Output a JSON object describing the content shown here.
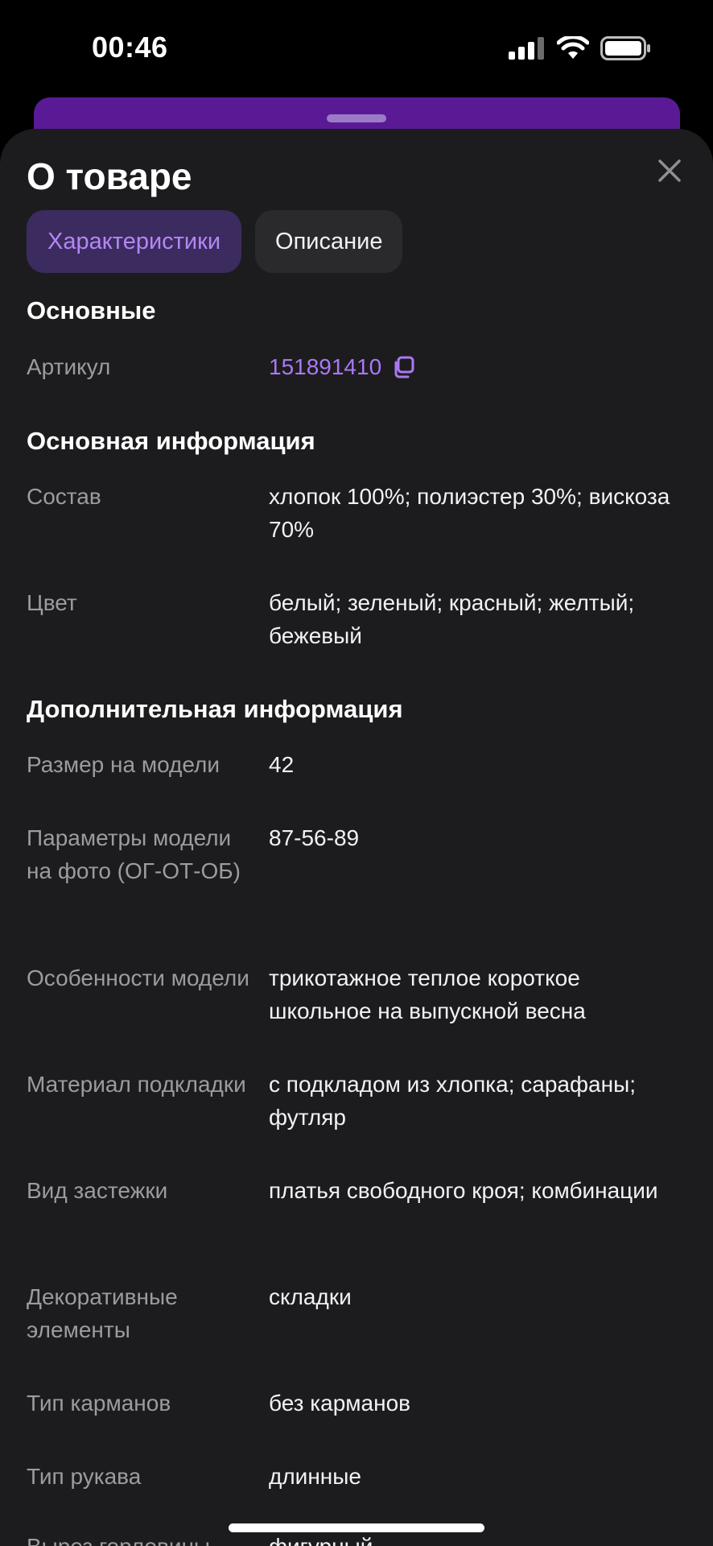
{
  "status_bar": {
    "time": "00:46",
    "icons": [
      "cellular-signal-icon",
      "wifi-icon",
      "battery-icon"
    ]
  },
  "sheet": {
    "title": "О товаре",
    "close_icon": "close-icon",
    "tabs": [
      {
        "label": "Характеристики",
        "active": true
      },
      {
        "label": "Описание",
        "active": false
      }
    ]
  },
  "sections": {
    "main": {
      "title": "Основные",
      "rows": [
        {
          "label": "Артикул",
          "value": "151891410",
          "icon": "copy-icon"
        }
      ]
    },
    "basic_info": {
      "title": "Основная информация",
      "rows": [
        {
          "label": "Состав",
          "value": "хлопок 100%; полиэстер 30%; вискоза 70%"
        },
        {
          "label": "Цвет",
          "value": "белый; зеленый; красный; желтый; бежевый"
        }
      ]
    },
    "extra_info": {
      "title": "Дополнительная информация",
      "rows": [
        {
          "label": "Размер на модели",
          "value": "42"
        },
        {
          "label": "Параметры модели на фото (ОГ-ОТ-ОБ)",
          "value": "87-56-89"
        },
        {
          "label": "Особенности модели",
          "value": "трикотажное теплое короткое школьное на выпускной весна"
        },
        {
          "label": "Материал подкладки",
          "value": "с подкладом из хлопка; сарафаны; футляр"
        },
        {
          "label": "Вид застежки",
          "value": "платья свободного кроя; комбинации"
        },
        {
          "label": "Декоративные элементы",
          "value": "складки"
        },
        {
          "label": "Тип карманов",
          "value": "без карманов"
        },
        {
          "label": "Тип рукава",
          "value": "длинные"
        },
        {
          "label": "Вырез горловины",
          "value": "фигурный"
        }
      ]
    }
  },
  "colors": {
    "accent": "#a979f2",
    "sheet_bg": "#1c1c1e",
    "back_sheet": "#5a1a95"
  }
}
